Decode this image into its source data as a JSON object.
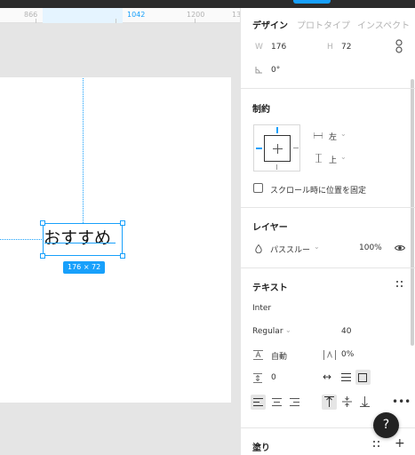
{
  "ruler": {
    "labels": [
      "866",
      "1042",
      "1200",
      "13"
    ]
  },
  "canvas": {
    "selected_text": "おすすめ",
    "size_tag": "176 × 72"
  },
  "panel": {
    "tabs": [
      "デザイン",
      "プロトタイプ",
      "インスペクト"
    ],
    "dimensions": {
      "w_label": "W",
      "w_value": "176",
      "h_label": "H",
      "h_value": "72"
    },
    "rotation": "0°",
    "constraints": {
      "title": "制約",
      "horizontal": "左",
      "vertical": "上",
      "fix_on_scroll": "スクロール時に位置を固定"
    },
    "layer": {
      "title": "レイヤー",
      "blend_mode": "パススルー",
      "opacity": "100%"
    },
    "text": {
      "title": "テキスト",
      "font_family": "Inter",
      "font_weight": "Regular",
      "font_size": "40",
      "line_height": "自動",
      "letter_spacing": "0%",
      "paragraph_spacing": "0"
    },
    "fill": {
      "title": "塗り"
    }
  },
  "help": {
    "label": "?"
  },
  "colors": {
    "accent": "#18a0fb",
    "topbar": "#2c2c2c",
    "canvas_bg": "#e5e5e5"
  }
}
